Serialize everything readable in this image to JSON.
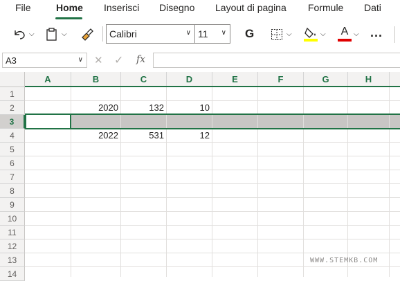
{
  "menu": {
    "tabs": [
      {
        "label": "File"
      },
      {
        "label": "Home"
      },
      {
        "label": "Inserisci"
      },
      {
        "label": "Disegno"
      },
      {
        "label": "Layout di pagina"
      },
      {
        "label": "Formule"
      },
      {
        "label": "Dati"
      }
    ],
    "active": "Home"
  },
  "toolbar": {
    "font_name": "Calibri",
    "font_size": "11",
    "bold_label": "G",
    "font_color_label": "A",
    "more_label": "...",
    "fill_color": "#ffff00",
    "font_color": "#e00000"
  },
  "formula_bar": {
    "name_box": "A3",
    "fx_label": "fx",
    "formula": ""
  },
  "columns": [
    "A",
    "B",
    "C",
    "D",
    "E",
    "F",
    "G",
    "H"
  ],
  "rows": [
    "1",
    "2",
    "3",
    "4",
    "5",
    "6",
    "7",
    "8",
    "9",
    "10",
    "11",
    "12",
    "13",
    "14"
  ],
  "cells": {
    "B2": "2020",
    "C2": "132",
    "D2": "10",
    "B4": "2022",
    "C4": "531",
    "D4": "12"
  },
  "selected_row": "3",
  "watermark": "WWW.STEMKB.COM",
  "accent_color": "#217346"
}
